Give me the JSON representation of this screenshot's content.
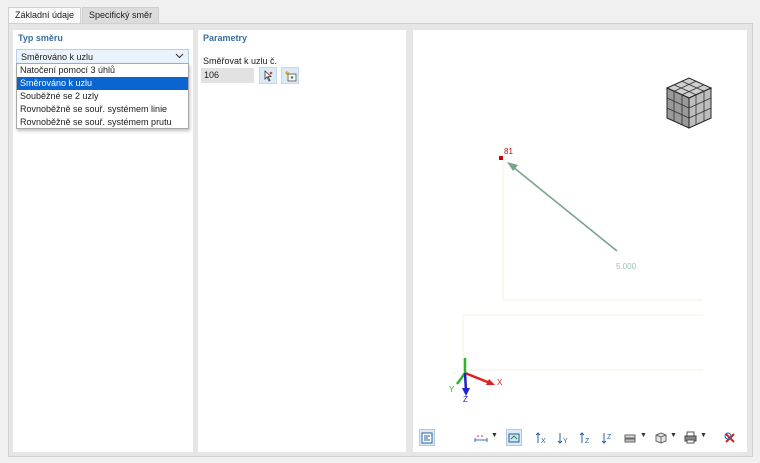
{
  "tabs": [
    {
      "label": "Základní údaje"
    },
    {
      "label": "Specifický směr"
    }
  ],
  "direction_type": {
    "title": "Typ směru",
    "selected": "Směrováno k uzlu",
    "options": [
      "Natočení pomocí 3 úhlů",
      "Směrováno k uzlu",
      "Souběžné se 2 uzly",
      "Rovnoběžně se souř. systémem linie",
      "Rovnoběžně se souř. systémem prutu"
    ]
  },
  "parameters": {
    "title": "Parametry",
    "node_label": "Směřovat k uzlu č.",
    "node_value": "106"
  },
  "viewport": {
    "node_label": "81",
    "length_label": "5.000",
    "axes": {
      "x": "X",
      "y": "Y",
      "z": "Z"
    },
    "colors": {
      "arrow": "#7aa38e",
      "node": "#cc0000",
      "x_axis": "#e02020",
      "y_axis": "#2cb52c",
      "z_axis": "#2020d0"
    }
  },
  "toolbar": {
    "icons": [
      "display-settings-icon",
      "dimension-icon",
      "render-icon",
      "view-x-icon",
      "view-minus-y-icon",
      "view-z-icon",
      "view-minus-z-icon",
      "layers-icon",
      "box-view-icon",
      "print-icon",
      "reset-icon"
    ]
  }
}
